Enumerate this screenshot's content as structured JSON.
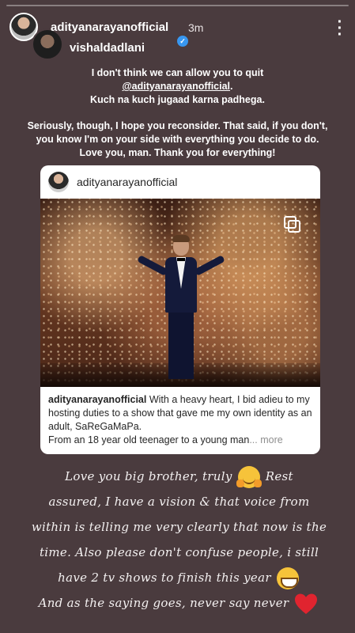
{
  "story": {
    "progress": 0.0,
    "primary_user": "adityanarayanofficial",
    "time_ago": "3m",
    "more_icon": "more-dots-icon",
    "secondary_user": "vishaldadlani",
    "verified_icon": "verified-badge-icon"
  },
  "message": {
    "line1": "I don't think we can allow you to quit",
    "mention": "@adityanarayanofficial",
    "line2_suffix": ".",
    "line3": "Kuch na kuch jugaad karna padhega.",
    "paragraph2": "Seriously, though, I hope you reconsider. That said, if you don't, you know I'm on your side with everything you decide to do. Love you, man. Thank you for everything!"
  },
  "shared_post": {
    "username": "adityanarayanofficial",
    "carousel_icon": "multiple-images-icon",
    "caption_user": "adityanarayanofficial",
    "caption_text": "With a heavy heart, I bid adieu to my hosting duties to a show that gave me my own identity as an adult, SaReGaMaPa.",
    "caption_line2": "From an 18 year old teenager to a young man",
    "caption_ellipsis": "...",
    "more_label": "more"
  },
  "overlay_text": {
    "line1a": "Love you big brother, truly",
    "line1b": "Rest",
    "line2": "assured, I have a vision & that voice from",
    "line3": "within is telling me very clearly that now is the",
    "line4": "time. Also please don't confuse people, i still",
    "line5": "have 2 tv shows to finish this year",
    "line6": "And as the saying goes, never say never",
    "emoji1": "hugging-face-emoji",
    "emoji2": "grinning-face-emoji",
    "emoji3": "red-heart-emoji"
  },
  "colors": {
    "background": "#4a3b3e",
    "verified": "#3897f0",
    "heart": "#e0242f"
  }
}
